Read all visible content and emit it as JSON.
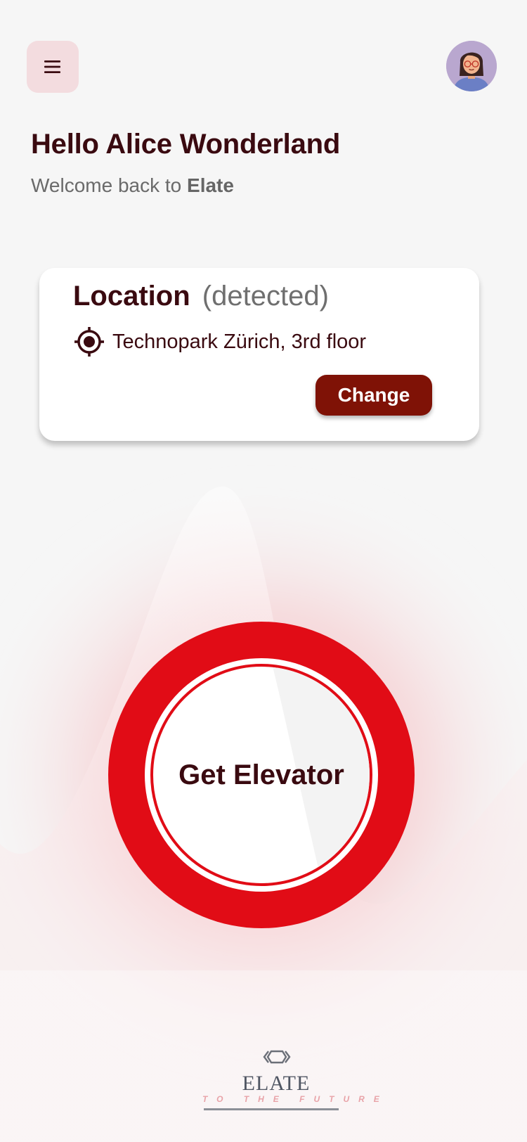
{
  "header": {
    "menu_icon": "hamburger-menu-icon",
    "avatar_icon": "user-avatar"
  },
  "greeting": {
    "title": "Hello Alice Wonderland",
    "welcome_prefix": "Welcome back to ",
    "app_name": "Elate"
  },
  "location_card": {
    "heading": "Location",
    "status": "(detected)",
    "icon": "location-target-icon",
    "location": "Technopark Zürich, 3rd floor",
    "change_label": "Change"
  },
  "elevator_button": {
    "label": "Get Elevator"
  },
  "footer_logo": {
    "wordmark": "ELATE",
    "tagline": "TO THE FUTURE"
  },
  "colors": {
    "accent_red": "#e10c16",
    "dark_red": "#7f1206",
    "text_dark": "#3a0a10",
    "menu_bg": "#f3dcdf",
    "background": "#f6f6f6"
  }
}
